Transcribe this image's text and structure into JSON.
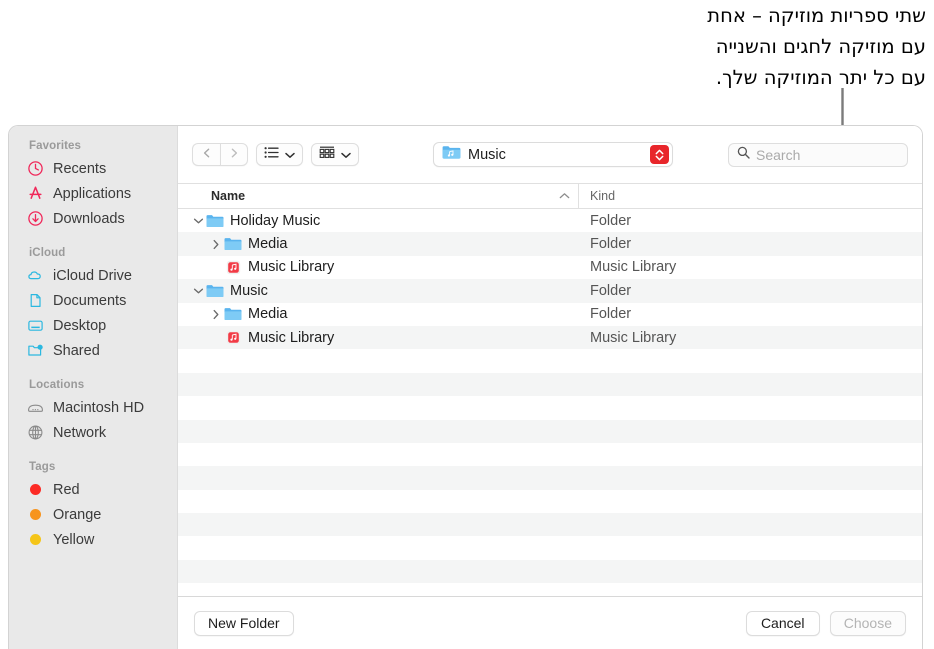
{
  "callout": {
    "text": "שתי ספריות מוזיקה – אחת\nעם מוזיקה לחגים והשנייה\nעם כל יתר המוזיקה שלך."
  },
  "sidebar": {
    "groups": [
      {
        "title": "Favorites",
        "items": [
          {
            "label": "Recents",
            "icon": "clock-icon",
            "color": "#f0285a"
          },
          {
            "label": "Applications",
            "icon": "app-store-icon",
            "color": "#f0285a"
          },
          {
            "label": "Downloads",
            "icon": "download-icon",
            "color": "#f0285a"
          }
        ]
      },
      {
        "title": "iCloud",
        "items": [
          {
            "label": "iCloud Drive",
            "icon": "cloud-icon",
            "color": "#2bb8e0"
          },
          {
            "label": "Documents",
            "icon": "document-icon",
            "color": "#2bb8e0"
          },
          {
            "label": "Desktop",
            "icon": "desktop-icon",
            "color": "#2bb8e0"
          },
          {
            "label": "Shared",
            "icon": "shared-folder-icon",
            "color": "#2bb8e0"
          }
        ]
      },
      {
        "title": "Locations",
        "items": [
          {
            "label": "Macintosh HD",
            "icon": "hard-drive-icon",
            "color": "#8a8a8a"
          },
          {
            "label": "Network",
            "icon": "globe-icon",
            "color": "#8a8a8a"
          }
        ]
      },
      {
        "title": "Tags",
        "items": [
          {
            "label": "Red",
            "icon": "tag-dot-icon",
            "color": "#fc2b25"
          },
          {
            "label": "Orange",
            "icon": "tag-dot-icon",
            "color": "#f7941e"
          },
          {
            "label": "Yellow",
            "icon": "tag-dot-icon",
            "color": "#f5c518"
          }
        ]
      }
    ]
  },
  "toolbar": {
    "back_icon": "chevron-left-icon",
    "forward_icon": "chevron-right-icon",
    "view_icon": "list-view-icon",
    "group_icon": "group-by-icon",
    "path_label": "Music",
    "path_icon": "music-folder-icon",
    "stepper_icon": "stepper-chevrons-icon",
    "stepper_color": "#e8262b",
    "search_icon": "search-icon",
    "search_placeholder": "Search",
    "search_value": ""
  },
  "columns": {
    "name": "Name",
    "kind": "Kind",
    "sort_icon": "sort-ascending-icon"
  },
  "rows": [
    {
      "name": "Holiday Music",
      "kind": "Folder",
      "indent": 0,
      "disclosure": "expanded",
      "icon": "folder-icon"
    },
    {
      "name": "Media",
      "kind": "Folder",
      "indent": 1,
      "disclosure": "collapsed",
      "icon": "folder-icon"
    },
    {
      "name": "Music Library",
      "kind": "Music Library",
      "indent": 1,
      "disclosure": "none",
      "icon": "music-library-icon"
    },
    {
      "name": "Music",
      "kind": "Folder",
      "indent": 0,
      "disclosure": "expanded",
      "icon": "folder-icon"
    },
    {
      "name": "Media",
      "kind": "Folder",
      "indent": 1,
      "disclosure": "collapsed",
      "icon": "folder-icon"
    },
    {
      "name": "Music Library",
      "kind": "Music Library",
      "indent": 1,
      "disclosure": "none",
      "icon": "music-library-icon"
    }
  ],
  "empty_row_count": 10,
  "footer": {
    "new_folder_label": "New Folder",
    "cancel_label": "Cancel",
    "choose_label": "Choose",
    "choose_disabled": true
  }
}
